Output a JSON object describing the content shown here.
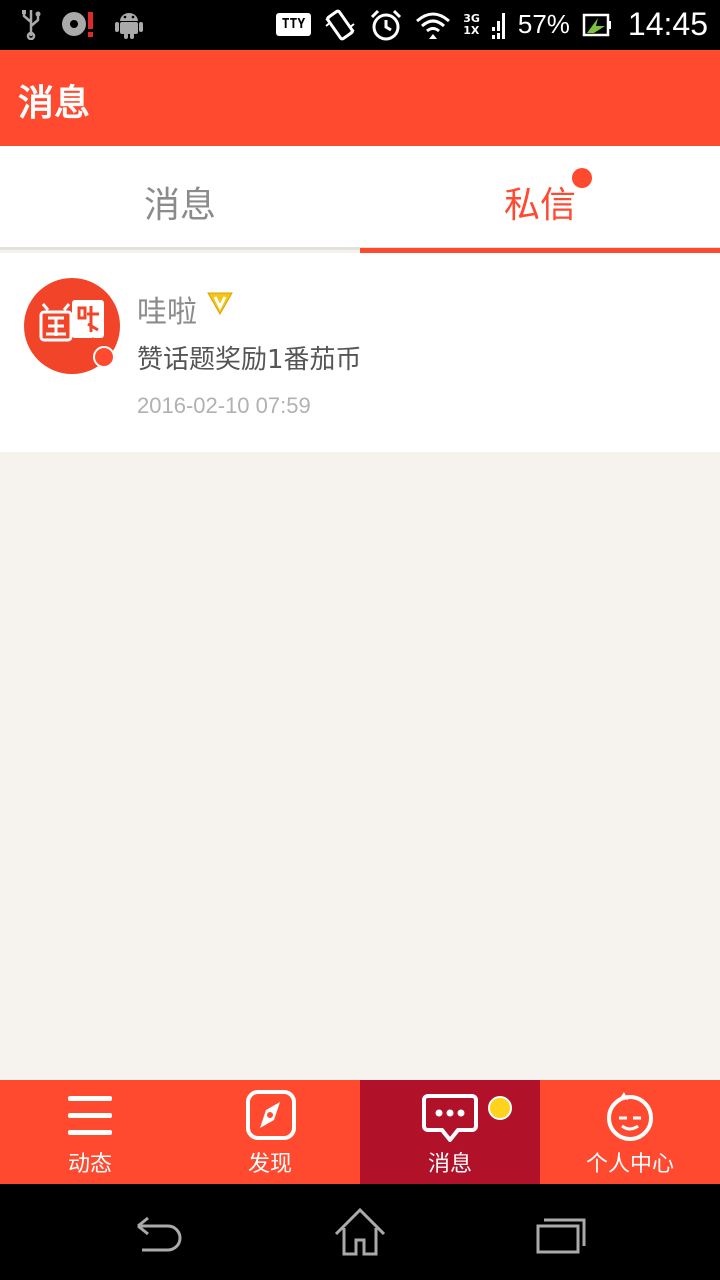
{
  "status_bar": {
    "tty": "TTY",
    "network_top": "3G",
    "network_bottom": "1X",
    "battery": "57%",
    "time": "14:45"
  },
  "header": {
    "title": "消息"
  },
  "tabs": [
    {
      "label": "消息",
      "selected": false
    },
    {
      "label": "私信",
      "selected": true
    }
  ],
  "messages": [
    {
      "sender": "哇啦",
      "preview": "赞话题奖励1番茄币",
      "time": "2016-02-10 07:59"
    }
  ],
  "bottom_nav": [
    {
      "label": "动态",
      "icon": "menu-icon"
    },
    {
      "label": "发现",
      "icon": "compass-icon"
    },
    {
      "label": "消息",
      "icon": "chat-icon",
      "active": true
    },
    {
      "label": "个人中心",
      "icon": "face-icon"
    }
  ],
  "colors": {
    "accent": "#ff4a30",
    "active_nav": "#b2112a",
    "badge": "#ffd21c"
  }
}
